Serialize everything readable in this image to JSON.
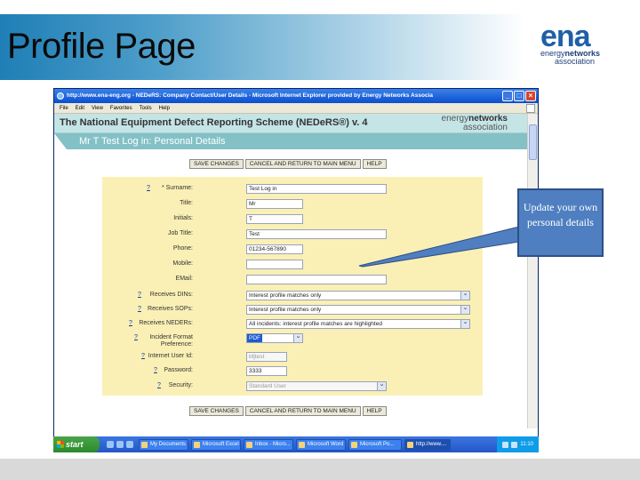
{
  "slide": {
    "title": "Profile Page",
    "logo": {
      "big": "ena",
      "line1_plain": "energy",
      "line1_bold": "networks",
      "line2": "association"
    },
    "callout": "Update your own personal details"
  },
  "browser": {
    "title": "http://www.ena-eng.org - NEDeRS: Company Contact/User Details - Microsoft Internet Explorer provided by Energy Networks Associa",
    "menu": [
      "File",
      "Edit",
      "View",
      "Favorites",
      "Tools",
      "Help"
    ],
    "buttons": {
      "minimize": "_",
      "maximize": "□",
      "close": "×"
    }
  },
  "app": {
    "title": "The National Equipment Defect Reporting Scheme (NEDeRS®) v. 4",
    "logo": {
      "plain": "energy",
      "bold": "networks",
      "line2": "association"
    },
    "subtitle": "Mr T Test Log in: Personal Details",
    "actions": {
      "save": "SAVE CHANGES",
      "cancel": "CANCEL AND RETURN TO MAIN MENU",
      "help": "HELP"
    }
  },
  "form": {
    "help_mark": "?",
    "fields": [
      {
        "label": "* Surname:",
        "value": "Test Log in",
        "help": true
      },
      {
        "label": "Title:",
        "value": "Mr",
        "help": false
      },
      {
        "label": "Initials:",
        "value": "T",
        "help": false
      },
      {
        "label": "Job Title:",
        "value": "Test",
        "help": false
      },
      {
        "label": "Phone:",
        "value": "01234-567890",
        "help": false
      },
      {
        "label": "Mobile:",
        "value": "",
        "help": false
      },
      {
        "label": "EMail:",
        "value": "",
        "help": false
      },
      {
        "label": "Receives DINs:",
        "value": "Interest profile matches only",
        "help": true
      },
      {
        "label": "Receives SOPs:",
        "value": "Interest profile matches only",
        "help": true
      },
      {
        "label": "Receives NEDERs:",
        "value": "All incidents: interest profile matches are highlighted",
        "help": true
      },
      {
        "label": "Incident Format Preference:",
        "value": "PDF",
        "help": true
      },
      {
        "label": "Internet User Id:",
        "value": "bfjtest",
        "help": true
      },
      {
        "label": "Password:",
        "value": "3333",
        "help": true
      },
      {
        "label": "Security:",
        "value": "Standard User",
        "help": true
      }
    ]
  },
  "taskbar": {
    "start": "start",
    "tasks": [
      "My Documents",
      "Microsoft Excel",
      "Inbox - Micro...",
      "Microsoft Word",
      "Microsoft Po...",
      "http://www...."
    ],
    "clock": "11:10"
  }
}
